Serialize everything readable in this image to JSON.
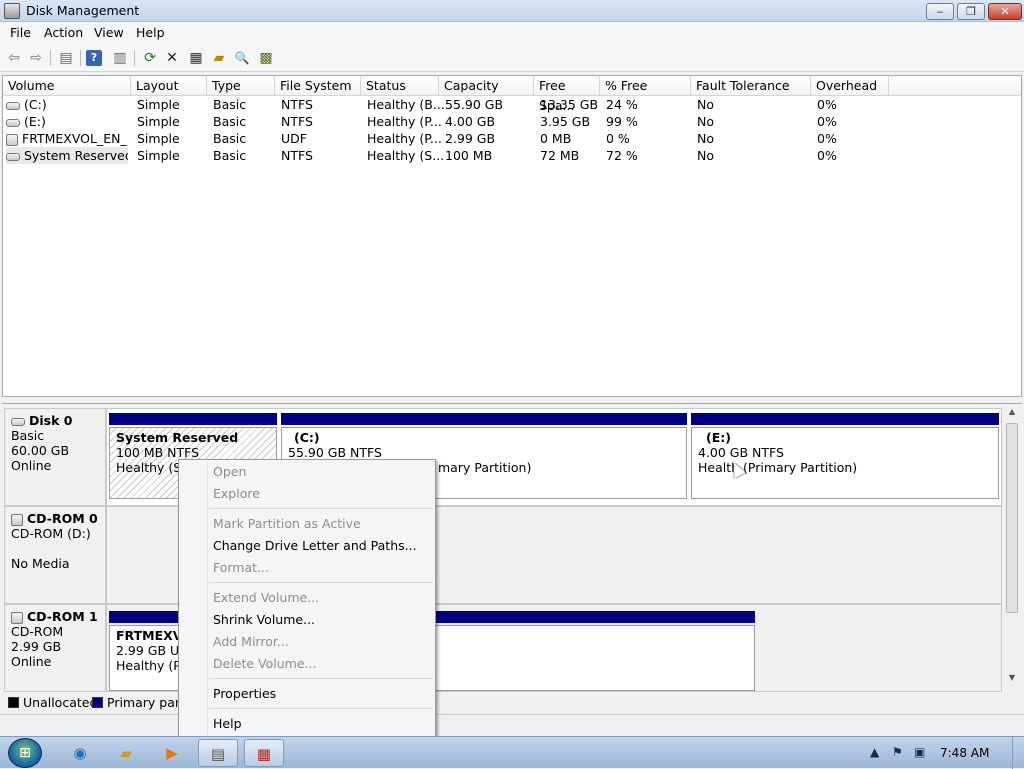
{
  "window": {
    "title": "Disk Management",
    "min_label": "‒",
    "max_label": "❐",
    "close_label": "✕"
  },
  "menu": [
    "File",
    "Action",
    "View",
    "Help"
  ],
  "toolbar": {
    "icons": [
      "back-arrow",
      "forward-arrow",
      "console-tree",
      "help",
      "show-hide",
      "refresh",
      "delete",
      "properties",
      "open",
      "explore",
      "rescan-disks"
    ],
    "glyphs": [
      "⇦",
      "⇨",
      "▤",
      "?",
      "▥",
      "⟳",
      "✕",
      "▦",
      "▰",
      "🔍",
      "▩"
    ]
  },
  "volume_list": {
    "columns": [
      "Volume",
      "Layout",
      "Type",
      "File System",
      "Status",
      "Capacity",
      "Free Spa...",
      "% Free",
      "Fault Tolerance",
      "Overhead"
    ],
    "rows": [
      [
        "(C:)",
        "Simple",
        "Basic",
        "NTFS",
        "Healthy (B...",
        "55.90 GB",
        "13.35 GB",
        "24 %",
        "No",
        "0%"
      ],
      [
        "(E:)",
        "Simple",
        "Basic",
        "NTFS",
        "Healthy (P...",
        "4.00 GB",
        "3.95 GB",
        "99 %",
        "No",
        "0%"
      ],
      [
        "FRTMEXVOL_EN_...",
        "Simple",
        "Basic",
        "UDF",
        "Healthy (P...",
        "2.99 GB",
        "0 MB",
        "0 %",
        "No",
        "0%"
      ],
      [
        "System Reserved",
        "Simple",
        "Basic",
        "NTFS",
        "Healthy (S...",
        "100 MB",
        "72 MB",
        "72 %",
        "No",
        "0%"
      ]
    ]
  },
  "disks": {
    "disk0": {
      "name": "Disk 0",
      "type": "Basic",
      "size": "60.00 GB",
      "state": "Online"
    },
    "cdrom0": {
      "name": "CD-ROM 0",
      "type": "CD-ROM (D:)",
      "state": "No Media"
    },
    "cdrom1": {
      "name": "CD-ROM 1",
      "type": "CD-ROM",
      "size": "2.99 GB",
      "state": "Online"
    }
  },
  "partitions": {
    "system_reserved": {
      "title": "System Reserved",
      "line1": "100 MB NTFS",
      "line2": "Healthy (Sys"
    },
    "c": {
      "title": "(C:)",
      "line1": "55.90 GB NTFS",
      "line2": "mary Partition)"
    },
    "e": {
      "title": "(E:)",
      "line1": "4.00 GB NTFS",
      "line2": "Health (Primary Partition)"
    },
    "frtmex": {
      "title": "FRTMEXVO",
      "line1": "2.99 GB UDF",
      "line2": "Healthy (Pri"
    }
  },
  "legend": {
    "unallocated": "Unallocated",
    "primary": "Primary partit"
  },
  "colors": {
    "primary_partition": "#000080",
    "unallocated": "#000000"
  },
  "context_menu": {
    "open": "Open",
    "explore": "Explore",
    "mark_active": "Mark Partition as Active",
    "change_letter": "Change Drive Letter and Paths...",
    "format": "Format...",
    "extend": "Extend Volume...",
    "shrink": "Shrink Volume...",
    "add_mirror": "Add Mirror...",
    "delete": "Delete Volume...",
    "properties": "Properties",
    "help": "Help"
  },
  "taskbar": {
    "clock": "7:48 AM",
    "start_glyph": "⊞"
  }
}
